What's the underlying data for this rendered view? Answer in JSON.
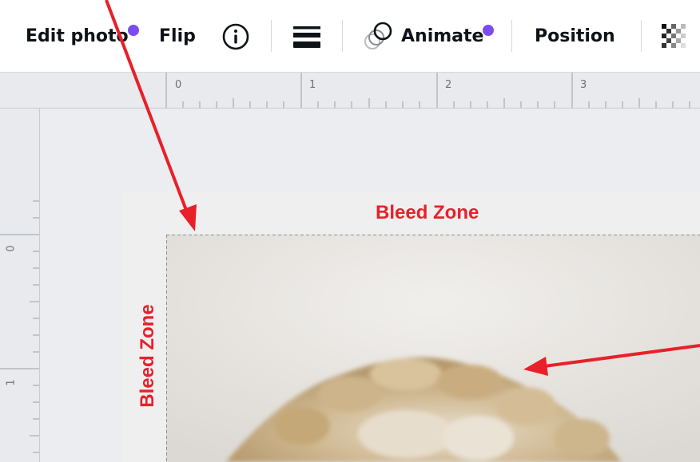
{
  "toolbar": {
    "edit_photo_label": "Edit photo",
    "flip_label": "Flip",
    "animate_label": "Animate",
    "position_label": "Position",
    "icons": [
      "info-icon",
      "line-spacing-icon",
      "animate-icon",
      "transparency-icon"
    ],
    "badge_color": "#7d4cf0"
  },
  "ruler": {
    "top_labels": [
      "0",
      "1",
      "2",
      "3"
    ],
    "left_labels": [
      "0",
      "1"
    ]
  },
  "canvas": {
    "bleed_top_label": "Bleed Zone",
    "bleed_left_label": "Bleed Zone",
    "annotation_color": "#e8202a"
  }
}
